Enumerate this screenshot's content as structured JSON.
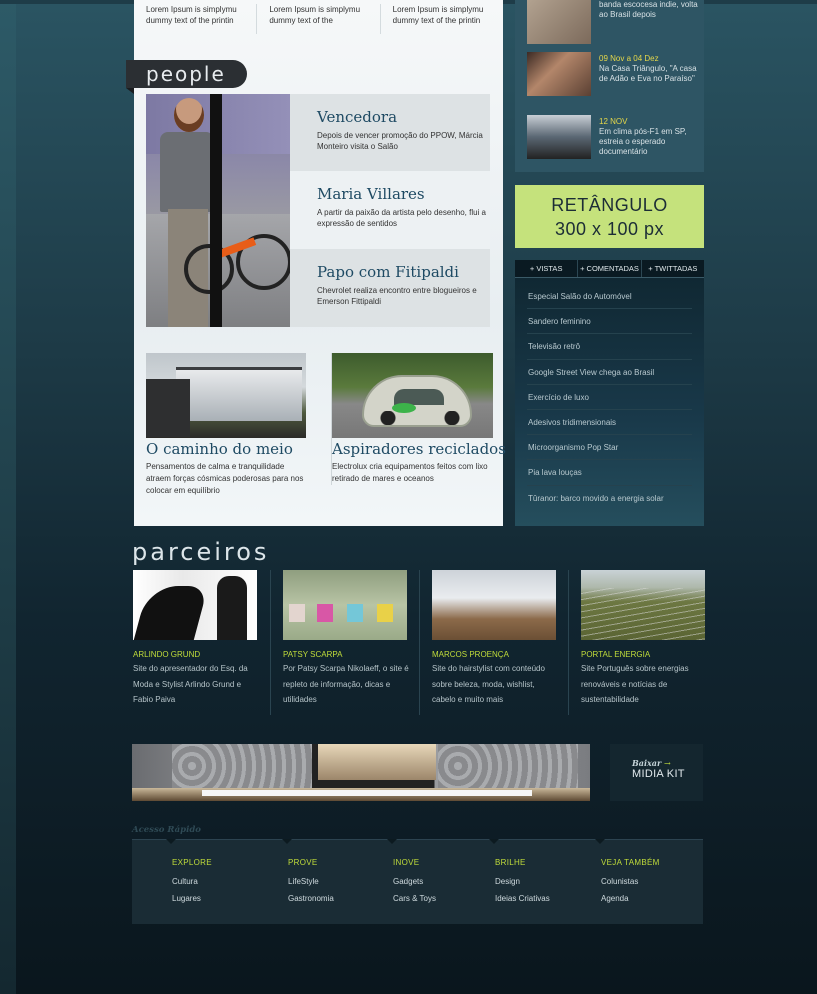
{
  "top_lorem": [
    "Lorem Ipsum is simplymu dummy text of the printin",
    "Lorem Ipsum is simplymu dummy text of the",
    "Lorem Ipsum is simplymu dummy text of the printin"
  ],
  "people": {
    "title": "people",
    "features": [
      {
        "title": "Vencedora",
        "text": "Depois de vencer promoção do PPOW, Márcia Monteiro visita o Salão"
      },
      {
        "title": "Maria Villares",
        "text": "A partir da paixão da artista pelo desenho, flui a expressão de sentidos"
      },
      {
        "title": "Papo com Fitipaldi",
        "text": "Chevrolet realiza encontro entre blogueiros e Emerson Fittipaldi"
      }
    ],
    "stories": [
      {
        "title": "O caminho do meio",
        "text": "Pensamentos de calma e tranquilidade atraem forças cósmicas poderosas para nos colocar em equilíbrio"
      },
      {
        "title": "Aspiradores reciclados",
        "text": "Electrolux cria equipamentos feitos com lixo retirado de mares e oceanos"
      }
    ]
  },
  "news": [
    {
      "date": "",
      "text": "banda escocesa indie, volta ao Brasil depois"
    },
    {
      "date": "09 Nov a 04 Dez",
      "text": "Na Casa Triângulo, \"A casa de Adão e Eva no Paraíso\""
    },
    {
      "date": "12 NOV",
      "text": "Em clima pós-F1 em SP, estreia o esperado documentário"
    }
  ],
  "ad": {
    "line1": "RETÂNGULO",
    "line2": "300 x 100 px"
  },
  "most": {
    "tabs": [
      "+ VISTAS",
      "+ COMENTADAS",
      "+ TWITTADAS"
    ],
    "items": [
      "Especial Salão do Automóvel",
      "Sandero feminino",
      "Televisão retrô",
      "Google Street View chega ao Brasil",
      "Exercício de luxo",
      "Adesivos tridimensionais",
      "Microorganismo Pop Star",
      "Pia lava louças",
      "Tûranor: barco movido a energia solar"
    ]
  },
  "parceiros": {
    "title": "parceiros",
    "items": [
      {
        "name": "ARLINDO GRUND",
        "desc": "Site do apresentador do Esq. da Moda e Stylist Arlindo Grund e Fabio Paiva"
      },
      {
        "name": "PATSY SCARPA",
        "desc": "Por Patsy Scarpa Nikolaeff, o site é repleto de informação, dicas e utilidades"
      },
      {
        "name": "MARCOS PROENÇA",
        "desc": "Site do hairstylist com conteúdo sobre beleza, moda, wishlist, cabelo e muito mais"
      },
      {
        "name": "PORTAL ENERGIA",
        "desc": "Site Português sobre energias renováveis e notícias de sustentabilidade"
      }
    ]
  },
  "midia_kit": {
    "small": "Baixar",
    "arrow": "→",
    "big": "MIDIA KIT"
  },
  "quick_access": {
    "title": "Acesso Rápido",
    "cols": [
      {
        "head": "EXPLORE",
        "items": [
          "Cultura",
          "Lugares"
        ]
      },
      {
        "head": "PROVE",
        "items": [
          "LifeStyle",
          "Gastronomia"
        ]
      },
      {
        "head": "INOVE",
        "items": [
          "Gadgets",
          "Cars & Toys"
        ]
      },
      {
        "head": "BRILHE",
        "items": [
          "Design",
          "Ideias Criativas"
        ]
      },
      {
        "head": "VEJA TAMBÉM",
        "items": [
          "Colunistas",
          "Agenda"
        ]
      }
    ]
  },
  "colors": {
    "accent_green": "#c0dc3a",
    "ad_bg": "#c5e27c",
    "headline_blue": "#1e4a63"
  }
}
